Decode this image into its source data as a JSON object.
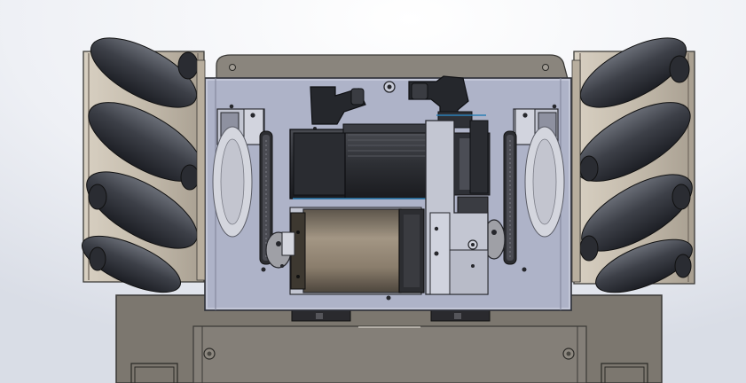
{
  "scene": {
    "subject": "cad-robot-chassis-top-view",
    "background_color": "#e6e9f0",
    "colors": {
      "chassis": "#7c776f",
      "chassis_edge": "#3a3936",
      "cover": "#847f78",
      "plate": "#aeb3c8",
      "plate_edge": "#2e3038",
      "roller": "#474b54",
      "roller_dark": "#1e2026",
      "wheel_frame": "#cfc6b8",
      "wheel_frame_shade": "#a79e90",
      "motor": "#3b3d43",
      "motor_dark": "#1a1b1f",
      "motor_accent": "#2b7fb5",
      "battery": "#827565",
      "battery_dark": "#3d3830",
      "bracket": "#c3c6d2",
      "belt": "#2c2d31",
      "pulley": "#9fa0a6"
    },
    "wheels": [
      "front-left",
      "front-right"
    ],
    "motors": [
      "drive-motor-left",
      "drive-motor-right"
    ],
    "batteries": [
      "battery-pack"
    ]
  }
}
